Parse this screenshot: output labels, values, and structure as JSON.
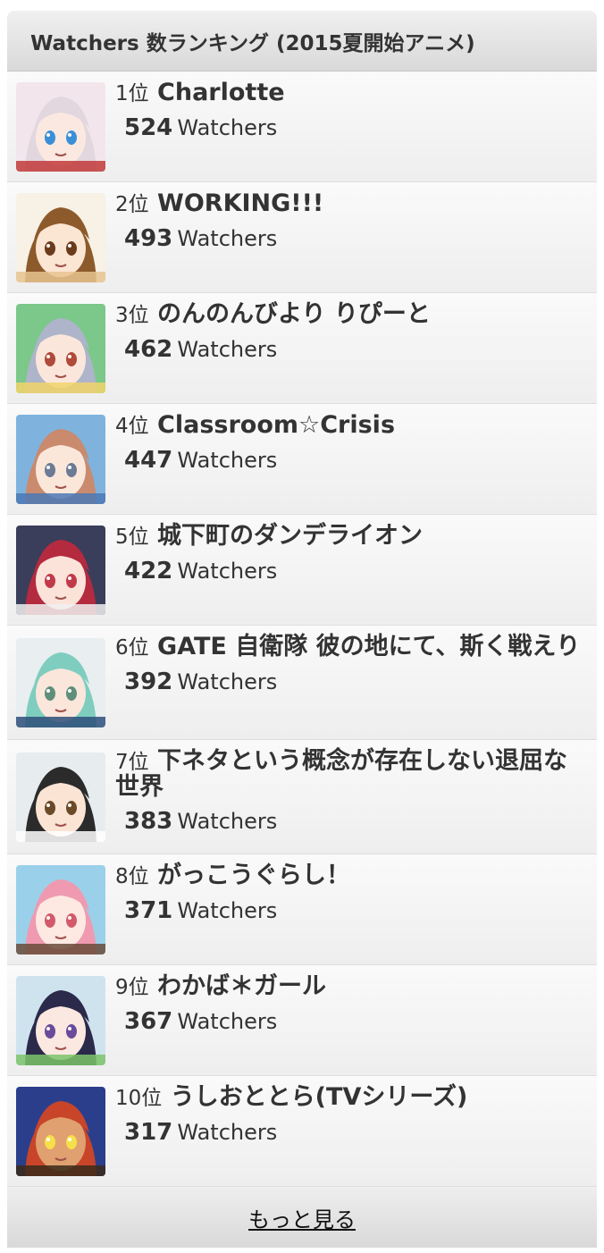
{
  "header": {
    "title": "Watchers 数ランキング (2015夏開始アニメ)"
  },
  "ranking": {
    "watchers_label": "Watchers",
    "items": [
      {
        "rank": "1位",
        "title": "Charlotte",
        "count": "524",
        "thumb": {
          "bg": "#f2e6ec",
          "hair": "#e2d7de",
          "skin": "#fbe9e1",
          "eye": "#3b8fd6",
          "accent": "#c23a3a"
        }
      },
      {
        "rank": "2位",
        "title": "WORKING!!!",
        "count": "493",
        "thumb": {
          "bg": "#f7f1e6",
          "hair": "#8c5a2b",
          "skin": "#fbe5d3",
          "eye": "#6b3b1e",
          "accent": "#e8c48f"
        }
      },
      {
        "rank": "3位",
        "title": "のんのんびより りぴーと",
        "count": "462",
        "thumb": {
          "bg": "#7bc88a",
          "hair": "#aeb4c9",
          "skin": "#fbe6dc",
          "eye": "#b04a3a",
          "accent": "#f1d36a"
        }
      },
      {
        "rank": "4位",
        "title": "Classroom☆Crisis",
        "count": "447",
        "thumb": {
          "bg": "#7fb3de",
          "hair": "#c98a6e",
          "skin": "#fbe7da",
          "eye": "#6b7a95",
          "accent": "#4a78b6"
        }
      },
      {
        "rank": "5位",
        "title": "城下町のダンデライオン",
        "count": "422",
        "thumb": {
          "bg": "#3a3e5a",
          "hair": "#b42a3e",
          "skin": "#fbe3da",
          "eye": "#c23a4a",
          "accent": "#f0f0f0"
        }
      },
      {
        "rank": "6位",
        "title": "GATE 自衛隊 彼の地にて、斯く戦えり",
        "count": "392",
        "thumb": {
          "bg": "#e9eef0",
          "hair": "#7fcdbe",
          "skin": "#fbe6dc",
          "eye": "#5f8f7a",
          "accent": "#2d4e7a"
        }
      },
      {
        "rank": "7位",
        "title": "下ネタという概念が存在しない退屈な世界",
        "count": "383",
        "thumb": {
          "bg": "#e7ecef",
          "hair": "#2b2b2b",
          "skin": "#fbe4d4",
          "eye": "#6b4a2a",
          "accent": "#ffffff"
        }
      },
      {
        "rank": "8位",
        "title": "がっこうぐらし！",
        "count": "371",
        "thumb": {
          "bg": "#9bd0ea",
          "hair": "#ef9ab0",
          "skin": "#fde9e2",
          "eye": "#d25a6a",
          "accent": "#6a4b3a"
        }
      },
      {
        "rank": "9位",
        "title": "わかば＊ガール",
        "count": "367",
        "thumb": {
          "bg": "#cfe3ef",
          "hair": "#2b2a4a",
          "skin": "#fbe8e0",
          "eye": "#6a4a9a",
          "accent": "#7bc46a"
        }
      },
      {
        "rank": "10位",
        "title": "うしおととら(TVシリーズ)",
        "count": "317",
        "thumb": {
          "bg": "#2b3e8c",
          "hair": "#c8452a",
          "skin": "#e0a070",
          "eye": "#f6e04a",
          "accent": "#3a2a1a"
        }
      }
    ]
  },
  "footer": {
    "more_label": "もっと見る"
  }
}
